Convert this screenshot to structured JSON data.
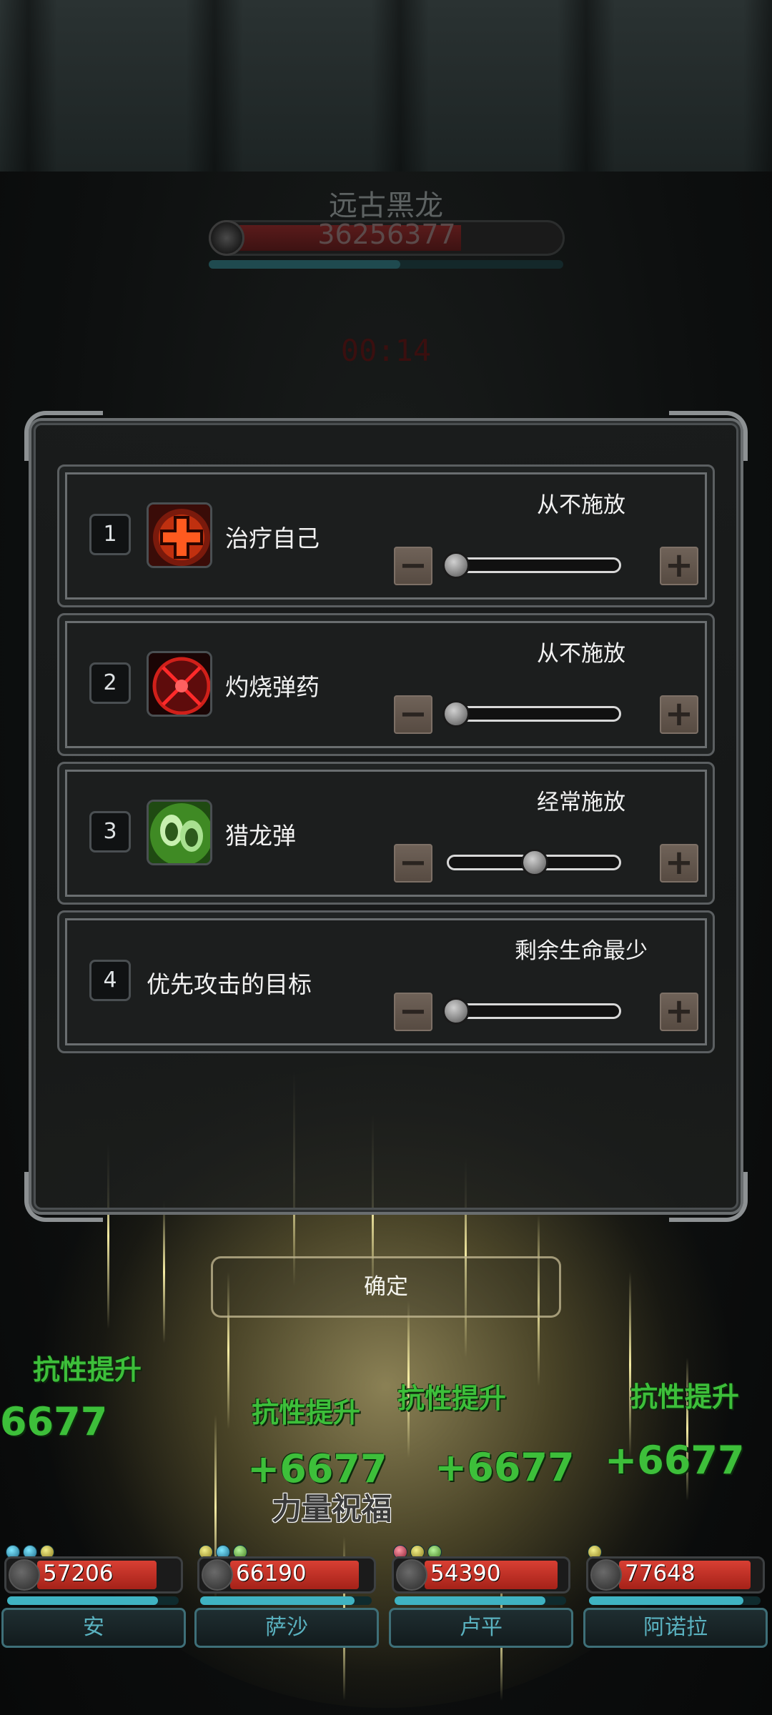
{
  "boss": {
    "name": "远古黑龙",
    "hp": "36256377",
    "hp_fraction": 0.62,
    "energy_fraction": 0.54,
    "timer": "00:14"
  },
  "skills": [
    {
      "index": "1",
      "name": "治疗自己",
      "level": "从不施放",
      "slider_fraction": 0.0,
      "icon": "heal-cross-icon"
    },
    {
      "index": "2",
      "name": "灼烧弹药",
      "level": "从不施放",
      "slider_fraction": 0.0,
      "icon": "burning-ammo-icon"
    },
    {
      "index": "3",
      "name": "猎龙弹",
      "level": "经常施放",
      "slider_fraction": 0.5,
      "icon": "dragon-hunt-bullet-icon"
    },
    {
      "index": "4",
      "name": "优先攻击的目标",
      "level": "剩余生命最少",
      "slider_fraction": 0.0
    }
  ],
  "stepper": {
    "minus": "−",
    "plus": "+"
  },
  "confirm_label": "确定",
  "floating_text": {
    "resist_label": "抗性提升",
    "heal_value": "+6677",
    "heal_value_cut": "6677",
    "buff_name": "力量祝福"
  },
  "party": [
    {
      "name": "安",
      "hp": "57206",
      "hp_fraction": 0.85,
      "mp_fraction": 0.88
    },
    {
      "name": "萨沙",
      "hp": "66190",
      "hp_fraction": 0.92,
      "mp_fraction": 0.9
    },
    {
      "name": "卢平",
      "hp": "54390",
      "hp_fraction": 0.95,
      "mp_fraction": 0.88
    },
    {
      "name": "阿诺拉",
      "hp": "77648",
      "hp_fraction": 0.94,
      "mp_fraction": 0.9
    }
  ],
  "colors": {
    "heal_text": "#3dbf3a",
    "hp_red": "#c7322a",
    "mp_teal": "#3fb3c2",
    "name_teal": "#5ab2c0"
  }
}
